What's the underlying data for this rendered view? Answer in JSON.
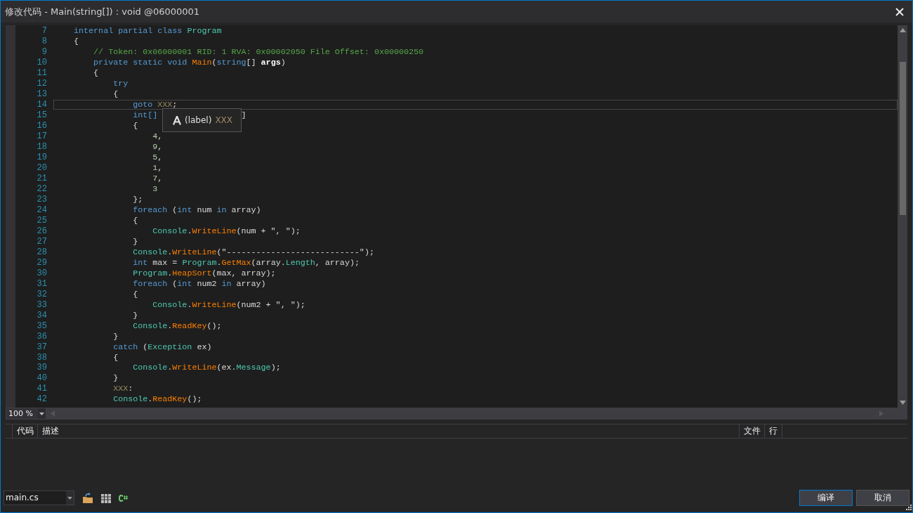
{
  "window": {
    "title": "修改代码 - Main(string[]) : void @06000001"
  },
  "editor": {
    "lines": [
      {
        "num": "7",
        "current": false,
        "tokens": [
          {
            "kind": "kw",
            "text": "    internal partial class "
          },
          {
            "kind": "type",
            "text": "Program"
          }
        ]
      },
      {
        "num": "8",
        "current": false,
        "tokens": [
          {
            "kind": "plain",
            "text": "    {"
          }
        ]
      },
      {
        "num": "9",
        "current": false,
        "tokens": [
          {
            "kind": "comment",
            "text": "        // Token: 0x06000001 RID: 1 RVA: 0x00002050 File Offset: 0x00000250"
          }
        ]
      },
      {
        "num": "10",
        "current": false,
        "tokens": [
          {
            "kind": "kw",
            "text": "        private static void "
          },
          {
            "kind": "method",
            "text": "Main"
          },
          {
            "kind": "plain",
            "text": "("
          },
          {
            "kind": "kw",
            "text": "string"
          },
          {
            "kind": "plain",
            "text": "[] "
          },
          {
            "kind": "param",
            "text": "args"
          },
          {
            "kind": "plain",
            "text": ")"
          }
        ]
      },
      {
        "num": "11",
        "current": false,
        "tokens": [
          {
            "kind": "plain",
            "text": "        {"
          }
        ]
      },
      {
        "num": "12",
        "current": false,
        "tokens": [
          {
            "kind": "kw",
            "text": "            try"
          }
        ]
      },
      {
        "num": "13",
        "current": false,
        "tokens": [
          {
            "kind": "plain",
            "text": "            {"
          }
        ]
      },
      {
        "num": "14",
        "current": true,
        "tokens": [
          {
            "kind": "kw",
            "text": "                goto "
          },
          {
            "kind": "label",
            "text": "XXX"
          },
          {
            "kind": "plain",
            "text": ";"
          }
        ]
      },
      {
        "num": "15",
        "current": false,
        "tokens": [
          {
            "kind": "kw",
            "text": "                int[]"
          },
          {
            "kind": "plain",
            "text": "]",
            "split": true
          }
        ]
      },
      {
        "num": "16",
        "current": false,
        "tokens": [
          {
            "kind": "plain",
            "text": "                {"
          }
        ]
      },
      {
        "num": "17",
        "current": false,
        "tokens": [
          {
            "kind": "num",
            "text": "                    4"
          },
          {
            "kind": "plain",
            "text": ","
          }
        ]
      },
      {
        "num": "18",
        "current": false,
        "tokens": [
          {
            "kind": "num",
            "text": "                    9"
          },
          {
            "kind": "plain",
            "text": ","
          }
        ]
      },
      {
        "num": "19",
        "current": false,
        "tokens": [
          {
            "kind": "num",
            "text": "                    5"
          },
          {
            "kind": "plain",
            "text": ","
          }
        ]
      },
      {
        "num": "20",
        "current": false,
        "tokens": [
          {
            "kind": "num",
            "text": "                    1"
          },
          {
            "kind": "plain",
            "text": ","
          }
        ]
      },
      {
        "num": "21",
        "current": false,
        "tokens": [
          {
            "kind": "num",
            "text": "                    7"
          },
          {
            "kind": "plain",
            "text": ","
          }
        ]
      },
      {
        "num": "22",
        "current": false,
        "tokens": [
          {
            "kind": "num",
            "text": "                    3"
          }
        ]
      },
      {
        "num": "23",
        "current": false,
        "tokens": [
          {
            "kind": "plain",
            "text": "                };"
          }
        ]
      },
      {
        "num": "24",
        "current": false,
        "tokens": [
          {
            "kind": "kw",
            "text": "                foreach"
          },
          {
            "kind": "plain",
            "text": " ("
          },
          {
            "kind": "kw",
            "text": "int"
          },
          {
            "kind": "plain",
            "text": " num "
          },
          {
            "kind": "kw",
            "text": "in"
          },
          {
            "kind": "plain",
            "text": " array)"
          }
        ]
      },
      {
        "num": "25",
        "current": false,
        "tokens": [
          {
            "kind": "plain",
            "text": "                {"
          }
        ]
      },
      {
        "num": "26",
        "current": false,
        "tokens": [
          {
            "kind": "type",
            "text": "                    Console"
          },
          {
            "kind": "plain",
            "text": "."
          },
          {
            "kind": "method",
            "text": "WriteLine"
          },
          {
            "kind": "plain",
            "text": "(num + \", \");"
          }
        ]
      },
      {
        "num": "27",
        "current": false,
        "tokens": [
          {
            "kind": "plain",
            "text": "                }"
          }
        ]
      },
      {
        "num": "28",
        "current": false,
        "tokens": [
          {
            "kind": "type",
            "text": "                Console"
          },
          {
            "kind": "plain",
            "text": "."
          },
          {
            "kind": "method",
            "text": "WriteLine"
          },
          {
            "kind": "plain",
            "text": "(\"---------------------------\");"
          }
        ]
      },
      {
        "num": "29",
        "current": false,
        "tokens": [
          {
            "kind": "kw",
            "text": "                int"
          },
          {
            "kind": "plain",
            "text": " max = "
          },
          {
            "kind": "type",
            "text": "Program"
          },
          {
            "kind": "plain",
            "text": "."
          },
          {
            "kind": "method",
            "text": "GetMax"
          },
          {
            "kind": "plain",
            "text": "(array."
          },
          {
            "kind": "prop",
            "text": "Length"
          },
          {
            "kind": "plain",
            "text": ", array);"
          }
        ]
      },
      {
        "num": "30",
        "current": false,
        "tokens": [
          {
            "kind": "type",
            "text": "                Program"
          },
          {
            "kind": "plain",
            "text": "."
          },
          {
            "kind": "method",
            "text": "HeapSort"
          },
          {
            "kind": "plain",
            "text": "(max, array);"
          }
        ]
      },
      {
        "num": "31",
        "current": false,
        "tokens": [
          {
            "kind": "kw",
            "text": "                foreach"
          },
          {
            "kind": "plain",
            "text": " ("
          },
          {
            "kind": "kw",
            "text": "int"
          },
          {
            "kind": "plain",
            "text": " num2 "
          },
          {
            "kind": "kw",
            "text": "in"
          },
          {
            "kind": "plain",
            "text": " array)"
          }
        ]
      },
      {
        "num": "32",
        "current": false,
        "tokens": [
          {
            "kind": "plain",
            "text": "                {"
          }
        ]
      },
      {
        "num": "33",
        "current": false,
        "tokens": [
          {
            "kind": "type",
            "text": "                    Console"
          },
          {
            "kind": "plain",
            "text": "."
          },
          {
            "kind": "method",
            "text": "WriteLine"
          },
          {
            "kind": "plain",
            "text": "(num2 + \", \");"
          }
        ]
      },
      {
        "num": "34",
        "current": false,
        "tokens": [
          {
            "kind": "plain",
            "text": "                }"
          }
        ]
      },
      {
        "num": "35",
        "current": false,
        "tokens": [
          {
            "kind": "type",
            "text": "                Console"
          },
          {
            "kind": "plain",
            "text": "."
          },
          {
            "kind": "method",
            "text": "ReadKey"
          },
          {
            "kind": "plain",
            "text": "();"
          }
        ]
      },
      {
        "num": "36",
        "current": false,
        "tokens": [
          {
            "kind": "plain",
            "text": "            }"
          }
        ]
      },
      {
        "num": "37",
        "current": false,
        "tokens": [
          {
            "kind": "kw",
            "text": "            catch"
          },
          {
            "kind": "plain",
            "text": " ("
          },
          {
            "kind": "type",
            "text": "Exception"
          },
          {
            "kind": "plain",
            "text": " ex)"
          }
        ]
      },
      {
        "num": "38",
        "current": false,
        "tokens": [
          {
            "kind": "plain",
            "text": "            {"
          }
        ]
      },
      {
        "num": "39",
        "current": false,
        "tokens": [
          {
            "kind": "type",
            "text": "                Console"
          },
          {
            "kind": "plain",
            "text": "."
          },
          {
            "kind": "method",
            "text": "WriteLine"
          },
          {
            "kind": "plain",
            "text": "(ex."
          },
          {
            "kind": "prop",
            "text": "Message"
          },
          {
            "kind": "plain",
            "text": ");"
          }
        ]
      },
      {
        "num": "40",
        "current": false,
        "tokens": [
          {
            "kind": "plain",
            "text": "            }"
          }
        ]
      },
      {
        "num": "41",
        "current": false,
        "tokens": [
          {
            "kind": "label",
            "text": "            XXX"
          },
          {
            "kind": "plain",
            "text": ":"
          }
        ]
      },
      {
        "num": "42",
        "current": false,
        "tokens": [
          {
            "kind": "type",
            "text": "            Console"
          },
          {
            "kind": "plain",
            "text": "."
          },
          {
            "kind": "method",
            "text": "ReadKey"
          },
          {
            "kind": "plain",
            "text": "();"
          }
        ]
      }
    ],
    "tooltip": {
      "kind_text": "(label)",
      "name": "XXX"
    },
    "zoom": "100 %"
  },
  "error_list": {
    "columns": [
      "代码",
      "描述",
      "文件",
      "行"
    ]
  },
  "footer": {
    "file": "main.cs",
    "buttons": [
      {
        "label": "编译",
        "focused": true
      },
      {
        "label": "取消",
        "focused": false
      }
    ]
  }
}
